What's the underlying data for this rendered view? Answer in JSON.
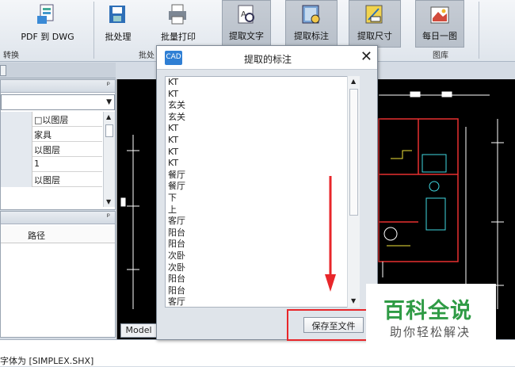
{
  "ribbon": {
    "buttons": [
      {
        "label": "PDF 到 DWG",
        "icon": "pdf-to-dwg-icon"
      },
      {
        "label": "批处理",
        "icon": "batch-icon"
      },
      {
        "label": "批量打印",
        "icon": "batch-print-icon"
      },
      {
        "label": "提取文字",
        "icon": "extract-text-icon"
      },
      {
        "label": "提取标注",
        "icon": "extract-annotation-icon"
      },
      {
        "label": "提取尺寸",
        "icon": "extract-dimension-icon"
      },
      {
        "label": "每日一图",
        "icon": "daily-drawing-icon"
      }
    ],
    "groups": [
      "转换",
      "批处",
      "图库"
    ]
  },
  "properties": {
    "rows": [
      "以图层",
      "家具",
      "以图层",
      "1",
      "以图层"
    ]
  },
  "paths_panel": {
    "header": "路径"
  },
  "model_tab": "Model",
  "status_text": "字体为 [SIMPLEX.SHX]",
  "dialog": {
    "title": "提取的标注",
    "icon_text": "CAD",
    "close": "✕",
    "items": [
      "KT",
      "KT",
      "玄关",
      "玄关",
      "KT",
      "KT",
      "KT",
      "KT",
      "餐厅",
      "餐厅",
      "下",
      "上",
      "客厅",
      "阳台",
      "阳台",
      "次卧",
      "次卧",
      "阳台",
      "阳台",
      "客厅"
    ],
    "save_button": "保存至文件"
  },
  "watermark": {
    "title": "百科全说",
    "subtitle": "助你轻松解决"
  },
  "colors": {
    "cad_bg": "#000000",
    "accent_red": "#e8262a",
    "watermark_green": "#2f9b45"
  }
}
